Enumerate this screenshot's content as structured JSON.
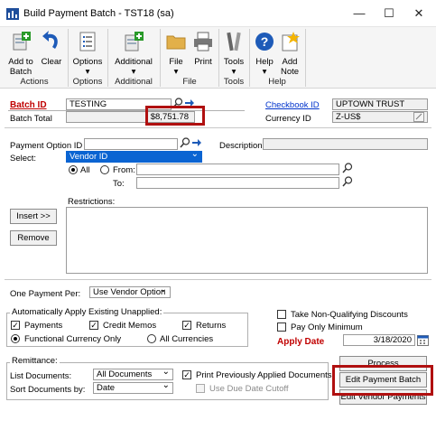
{
  "window": {
    "title": "Build Payment Batch  -  TST18 (sa)",
    "minimize": "—",
    "maximize": "☐",
    "close": "✕"
  },
  "ribbon": {
    "buttons": [
      {
        "label": "Add to\nBatch",
        "icon": "add-to-batch-icon"
      },
      {
        "label": "Clear",
        "icon": "undo-icon"
      },
      {
        "label": "Options\n▾",
        "icon": "options-list-icon"
      },
      {
        "label": "Additional\n▾",
        "icon": "additional-icon"
      },
      {
        "label": "File\n▾",
        "icon": "folder-icon"
      },
      {
        "label": "Print",
        "icon": "printer-icon"
      },
      {
        "label": "Tools\n▾",
        "icon": "tools-icon"
      },
      {
        "label": "Help\n▾",
        "icon": "help-icon"
      },
      {
        "label": "Add\nNote",
        "icon": "note-icon"
      }
    ],
    "groups": [
      "Actions",
      "Options",
      "Additional",
      "File",
      "Tools",
      "Help"
    ]
  },
  "form": {
    "batch_id_label": "Batch ID",
    "batch_id_value": "TESTING",
    "batch_total_label": "Batch Total",
    "batch_total_value": "$8,751.78",
    "checkbook_id_label": "Checkbook ID",
    "checkbook_id_value": "UPTOWN TRUST",
    "currency_id_label": "Currency ID",
    "currency_id_value": "Z-US$",
    "payment_option_id_label": "Payment Option ID",
    "description_label": "Description",
    "select_label": "Select:",
    "select_value": "Vendor ID",
    "all_label": "All",
    "from_label": "From:",
    "to_label": "To:",
    "restrictions_label": "Restrictions:",
    "insert_label": "Insert >>",
    "remove_label": "Remove",
    "one_payment_per_label": "One Payment Per:",
    "one_payment_per_value": "Use Vendor Option",
    "auto_apply_label": "Automatically Apply Existing Unapplied:",
    "payments_label": "Payments",
    "credit_memos_label": "Credit Memos",
    "returns_label": "Returns",
    "functional_currency_label": "Functional Currency Only",
    "all_currencies_label": "All Currencies",
    "take_nonqual_label": "Take Non-Qualifying Discounts",
    "pay_only_min_label": "Pay Only Minimum",
    "apply_date_label": "Apply Date",
    "apply_date_value": "3/18/2020",
    "remittance_label": "Remittance:",
    "list_documents_label": "List Documents:",
    "list_documents_value": "All Documents",
    "sort_documents_label": "Sort Documents by:",
    "sort_documents_value": "Date",
    "print_prev_applied_label": "Print Previously Applied Documents",
    "use_due_date_label": "Use Due Date Cutoff",
    "process_label": "Process",
    "edit_payment_batch_label": "Edit Payment Batch",
    "edit_vendor_payments_label": "Edit Vendor Payments"
  },
  "colors": {
    "highlight_box": "#b01010",
    "required_label": "#c00000",
    "link": "#0033cc",
    "selection": "#0a64d2"
  }
}
